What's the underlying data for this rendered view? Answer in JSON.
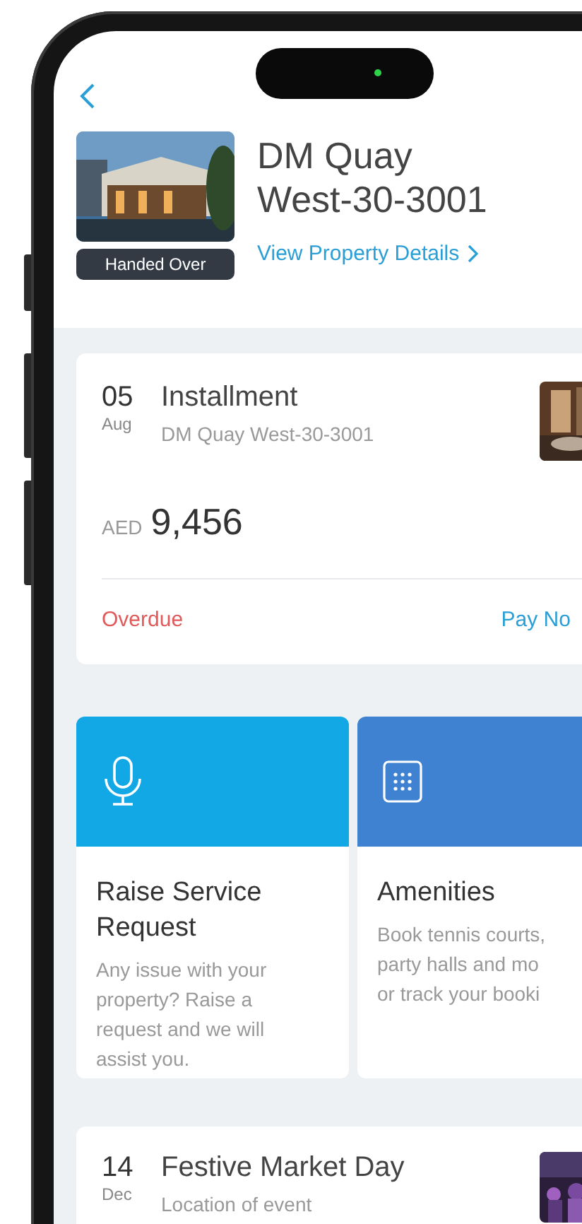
{
  "property": {
    "title": "DM Quay West-30-3001",
    "status": "Handed Over",
    "link": "View Property Details"
  },
  "payments": [
    {
      "day": "05",
      "month": "Aug",
      "title": "Installment",
      "subtitle": "DM Quay West-30-3001",
      "currency": "AED",
      "amount": "9,456",
      "status": "Overdue",
      "overdue": true,
      "action": "Pay No"
    }
  ],
  "services": [
    {
      "kind": "microphone",
      "color": "#12a8e6",
      "title": "Raise Service Request",
      "lines": [
        "Any issue with your",
        "property? Raise a",
        "request and we will",
        "assist you."
      ]
    },
    {
      "kind": "grid",
      "color": "#3f82d1",
      "title": "Amenities",
      "lines": [
        "Book tennis courts,",
        "party halls and mo",
        "or track your booki"
      ]
    }
  ],
  "events": [
    {
      "day": "14",
      "month": "Dec",
      "title": "Festive Market Day",
      "subtitle": "Location of event"
    }
  ]
}
